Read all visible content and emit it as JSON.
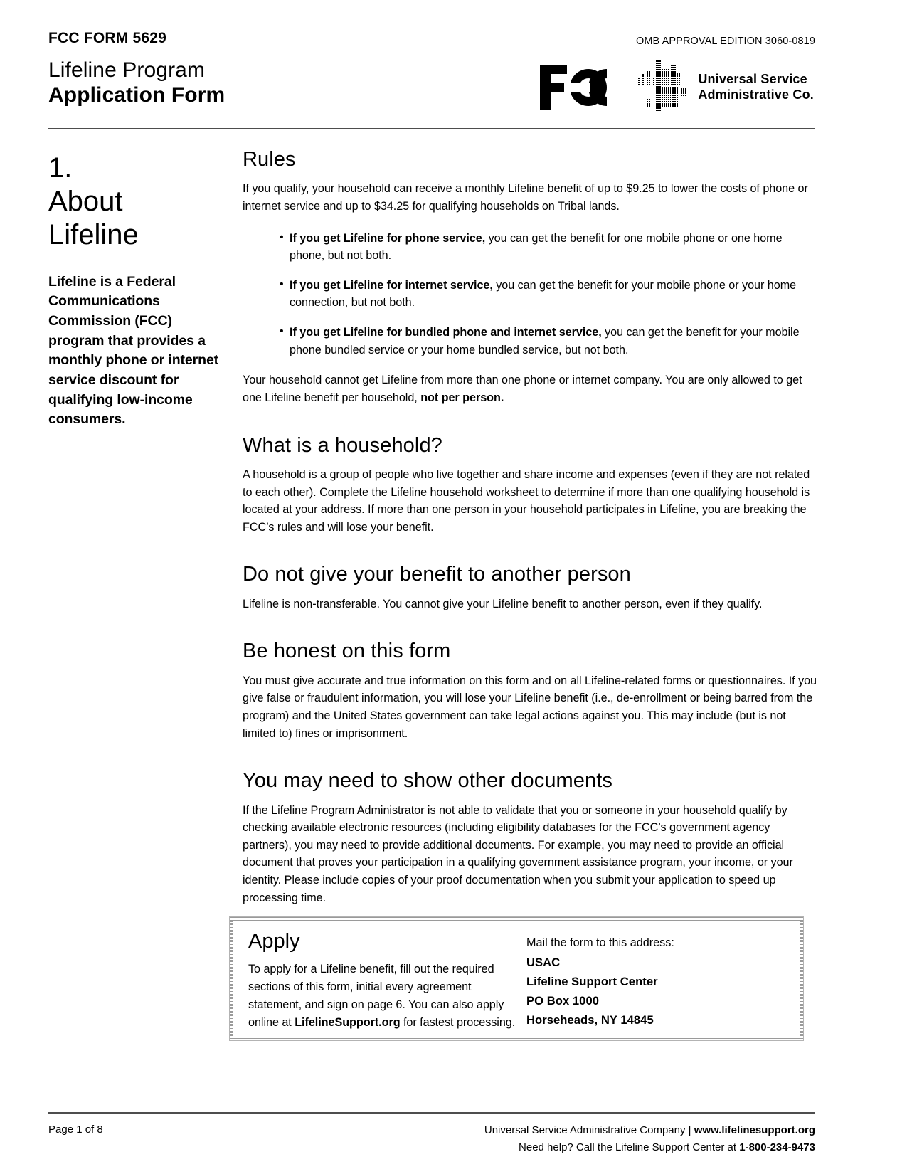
{
  "header": {
    "form_code": "FCC FORM 5629",
    "title_line1": "Lifeline Program",
    "title_line2": "Application Form",
    "omb": "OMB APPROVAL EDITION 3060-0819",
    "fcc_logo_alt": "FCC",
    "usac_line1": "Universal Service",
    "usac_line2": "Administrative Co."
  },
  "sidebar": {
    "section_number": "1.",
    "section_title_line1": "About",
    "section_title_line2": "Lifeline",
    "description": "Lifeline is a Federal Communications Commission (FCC) program that provides a monthly phone or internet service discount for qualifying low-income consumers."
  },
  "main": {
    "rules": {
      "heading": "Rules",
      "intro": "If you qualify, your household can receive a monthly Lifeline benefit of up to $9.25 to lower the costs of phone or internet service and up to $34.25 for qualifying households on Tribal lands.",
      "bullets": [
        {
          "bold": "If you get Lifeline for phone service,",
          "rest": " you can get the benefit for one mobile phone or one home phone, but not both."
        },
        {
          "bold": "If you get Lifeline for internet service,",
          "rest": " you can get the benefit for your mobile phone or your home connection, but not both."
        },
        {
          "bold": "If you get Lifeline for bundled phone and internet service,",
          "rest": " you can get the benefit for your mobile phone bundled service or your home bundled service, but not both."
        }
      ],
      "closing_prefix": "Your household cannot get Lifeline from more than one phone or internet company. You are only allowed to get one Lifeline benefit per household, ",
      "closing_bold": "not per person."
    },
    "household": {
      "heading": "What is a household?",
      "body": "A household is a group of people who live together and share income and expenses (even if they are not related to each other). Complete the Lifeline household worksheet to determine if more than one qualifying household is located at your address. If more than one person in your household participates in Lifeline, you are breaking the FCC’s rules and will lose your benefit."
    },
    "transfer": {
      "heading": "Do not give your benefit to another person",
      "body": "Lifeline is non-transferable. You cannot give your Lifeline benefit to another person, even if they qualify."
    },
    "honest": {
      "heading": "Be honest on this form",
      "body": "You must give accurate and true information on this form and on all Lifeline-related forms or questionnaires. If you give false or fraudulent information, you will lose your Lifeline benefit (i.e., de-enrollment or being barred from the program) and the United States government can take legal actions against you. This may include (but is not limited to) fines or imprisonment."
    },
    "documents": {
      "heading": "You may need to show other documents",
      "body": "If the Lifeline Program Administrator is not able to validate that you or someone in your household qualify by checking available electronic resources (including eligibility databases for the FCC’s government agency partners), you may need to provide additional documents. For example, you may need to provide an official document that proves your participation in a qualifying government assistance program, your income, or your identity. Please include copies of your proof documentation when you submit your application to speed up processing time."
    }
  },
  "apply_box": {
    "title": "Apply",
    "text_part1": "To apply for a Lifeline benefit, fill out the required sections of this form, initial every agreement statement, and sign on page 6. You can also apply online at ",
    "text_bold": "LifelineSupport.org",
    "text_part2": " for fastest processing.",
    "mail_label": "Mail the form to this address:",
    "address": [
      "USAC",
      "Lifeline Support Center",
      "PO Box 1000",
      "Horseheads, NY 14845"
    ]
  },
  "footer": {
    "page_number": "Page 1 of 8",
    "org_text": "Universal Service Administrative Company  |  ",
    "org_site": "www.lifelinesupport.org",
    "help_text": "Need help? Call the Lifeline Support Center at ",
    "help_phone": "1-800-234-9473"
  }
}
